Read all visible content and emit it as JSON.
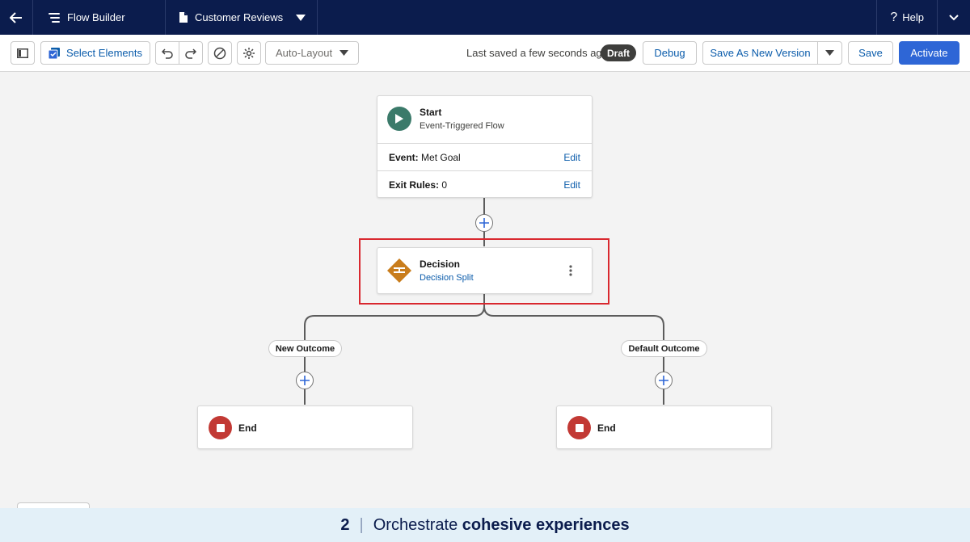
{
  "topbar": {
    "app_name": "Flow Builder",
    "document_name": "Customer Reviews",
    "help_label": "Help"
  },
  "toolbar": {
    "select_elements_label": "Select Elements",
    "layout_mode": "Auto-Layout",
    "last_saved": "Last saved a few seconds ago",
    "status_badge": "Draft",
    "debug_label": "Debug",
    "save_as_new_version_label": "Save As New Version",
    "save_label": "Save",
    "activate_label": "Activate"
  },
  "flow": {
    "start": {
      "title": "Start",
      "subtitle": "Event-Triggered Flow",
      "event_label": "Event:",
      "event_value": "Met Goal",
      "exit_rules_label": "Exit Rules:",
      "exit_rules_value": "0",
      "edit_label": "Edit"
    },
    "decision": {
      "title": "Decision",
      "subtitle": "Decision Split"
    },
    "outcomes": [
      {
        "label": "New Outcome",
        "end_label": "End"
      },
      {
        "label": "Default Outcome",
        "end_label": "End"
      }
    ]
  },
  "caption": {
    "number": "2",
    "separator": "|",
    "prefix": "Orchestrate",
    "emphasis": "cohesive experiences"
  },
  "colors": {
    "nav_bg": "#0b1c4d",
    "brand_blue": "#2e66d6",
    "start_green": "#3b7a6a",
    "decision_orange": "#c97d1c",
    "end_red": "#c23934",
    "highlight_red": "#d9282f"
  }
}
